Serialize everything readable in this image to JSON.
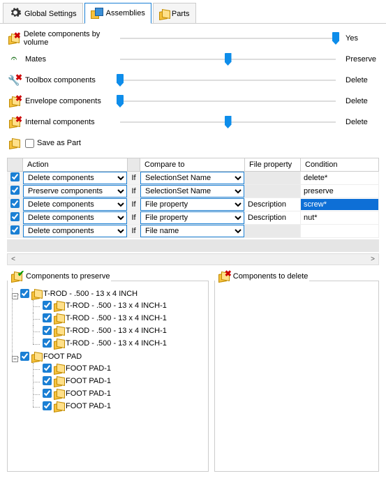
{
  "tabs": [
    {
      "label": "Global Settings",
      "active": false
    },
    {
      "label": "Assemblies",
      "active": true
    },
    {
      "label": "Parts",
      "active": false
    }
  ],
  "options": {
    "delete_by_volume": {
      "label": "Delete components by volume",
      "result": "Yes",
      "pos": 100
    },
    "mates": {
      "label": "Mates",
      "result": "Preserve",
      "pos": 50
    },
    "toolbox": {
      "label": "Toolbox components",
      "result": "Delete",
      "pos": 0
    },
    "envelope": {
      "label": "Envelope components",
      "result": "Delete",
      "pos": 0
    },
    "internal": {
      "label": "Internal components",
      "result": "Delete",
      "pos": 50
    },
    "save_as_part": {
      "label": "Save as Part",
      "checked": false
    }
  },
  "rules": {
    "headers": {
      "check": "",
      "action": "Action",
      "if": "",
      "compare": "Compare to",
      "fileprop": "File property",
      "condition": "Condition"
    },
    "if_label": "If",
    "rows": [
      {
        "checked": true,
        "action": "Delete components",
        "compare": "SelectionSet Name",
        "fileprop": "",
        "condition": "delete*",
        "selected": false
      },
      {
        "checked": true,
        "action": "Preserve components",
        "compare": "SelectionSet Name",
        "fileprop": "",
        "condition": "preserve",
        "selected": false
      },
      {
        "checked": true,
        "action": "Delete components",
        "compare": "File property",
        "fileprop": "Description",
        "condition": "screw*",
        "selected": true
      },
      {
        "checked": true,
        "action": "Delete components",
        "compare": "File property",
        "fileprop": "Description",
        "condition": "nut*",
        "selected": false
      },
      {
        "checked": true,
        "action": "Delete components",
        "compare": "File name",
        "fileprop": "",
        "condition": "",
        "selected": false
      }
    ]
  },
  "panels": {
    "preserve": {
      "title": "Components to preserve",
      "tree": [
        {
          "label": "T-ROD - .500 - 13 x  4 INCH",
          "children": [
            {
              "label": "T-ROD - .500 - 13 x  4 INCH-1"
            },
            {
              "label": "T-ROD - .500 - 13 x  4 INCH-1"
            },
            {
              "label": "T-ROD - .500 - 13 x  4 INCH-1"
            },
            {
              "label": "T-ROD - .500 - 13 x  4 INCH-1"
            }
          ]
        },
        {
          "label": "FOOT PAD",
          "children": [
            {
              "label": "FOOT PAD-1"
            },
            {
              "label": "FOOT PAD-1"
            },
            {
              "label": "FOOT PAD-1"
            },
            {
              "label": "FOOT PAD-1"
            }
          ]
        }
      ]
    },
    "delete": {
      "title": "Components to delete",
      "tree": []
    }
  }
}
